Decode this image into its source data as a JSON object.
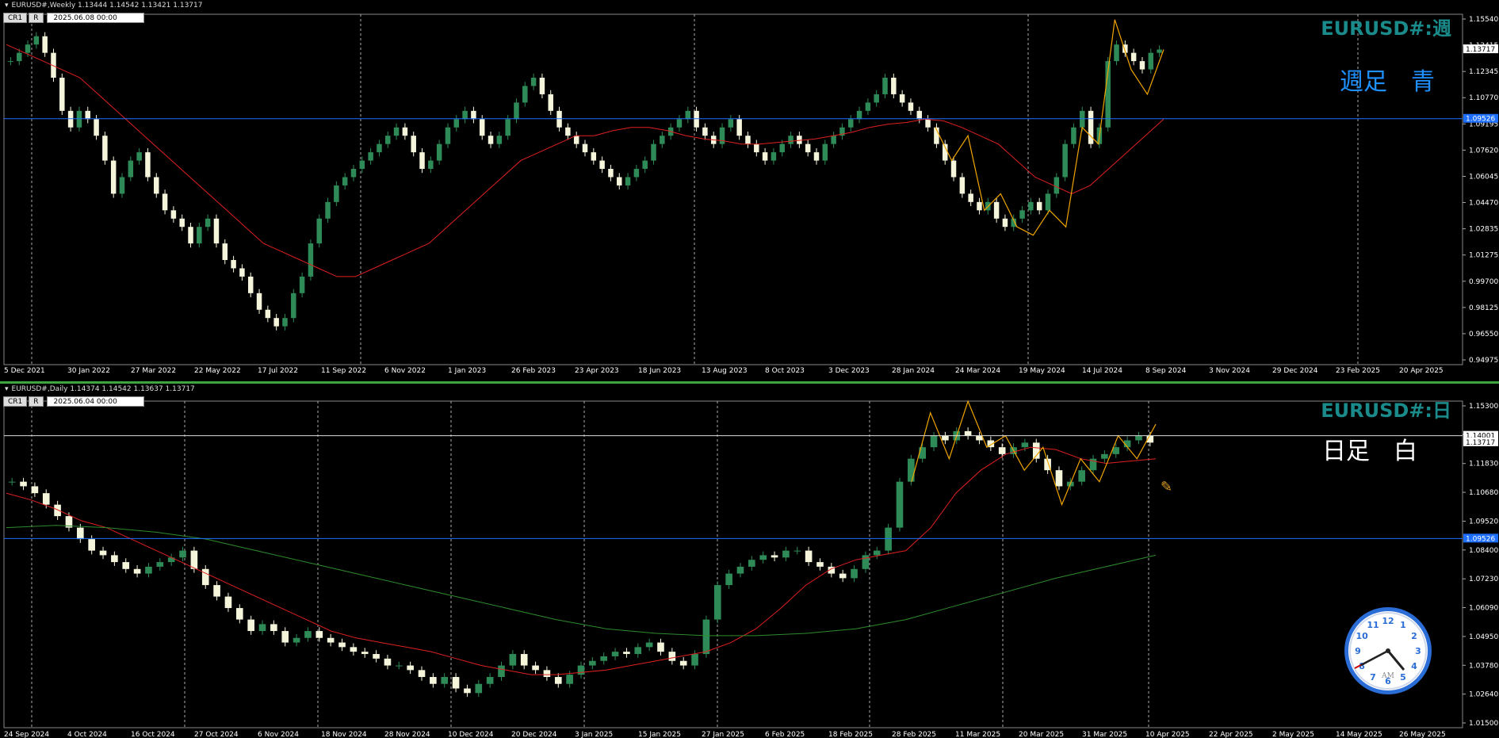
{
  "weekly": {
    "info": "EURUSD#,Weekly  1.13444 1.14542 1.13421 1.13717",
    "btn_cr": "CR1",
    "btn_r": "R",
    "datetime": "2025.06.08 00:00",
    "title": "EURUSD#:週",
    "subtitle": "週足　青",
    "subtitle_color": "#1e90ff",
    "hline_price": 1.09526,
    "hline_label": "1.09526",
    "last_label": "1.13717",
    "price_ticks": [
      "1.15540",
      "1.13415",
      "1.12345",
      "1.10770",
      "1.09195",
      "1.07620",
      "1.06045",
      "1.04470",
      "1.02835",
      "1.01275",
      "0.99700",
      "0.98125",
      "0.96550",
      "0.94975"
    ],
    "date_ticks": [
      "5 Dec 2021",
      "30 Jan 2022",
      "27 Mar 2022",
      "22 May 2022",
      "17 Jul 2022",
      "11 Sep 2022",
      "6 Nov 2022",
      "1 Jan 2023",
      "26 Feb 2023",
      "23 Apr 2023",
      "18 Jun 2023",
      "13 Aug 2023",
      "8 Oct 2023",
      "3 Dec 2023",
      "28 Jan 2024",
      "24 Mar 2024",
      "19 May 2024",
      "14 Jul 2024",
      "8 Sep 2024",
      "3 Nov 2024",
      "29 Dec 2024",
      "23 Feb 2025",
      "20 Apr 2025"
    ]
  },
  "daily": {
    "info": "EURUSD#,Daily  1.14374 1.14542 1.13637 1.13717",
    "btn_cr": "CR1",
    "btn_r": "R",
    "datetime": "2025.06.04 00:00",
    "title": "EURUSD#:日",
    "subtitle": "日足　白",
    "subtitle_color": "#ffffff",
    "hline_blue_price": 1.09526,
    "hline_blue_label": "1.09526",
    "hline_white_price": 1.14001,
    "hline_white_label": "1.14001",
    "last_label": "1.13717",
    "price_ticks": [
      "1.15300",
      "1.12990",
      "1.11830",
      "1.10680",
      "1.09520",
      "1.08400",
      "1.07230",
      "1.06090",
      "1.04950",
      "1.03780",
      "1.02640",
      "1.01500"
    ],
    "date_ticks": [
      "24 Sep 2024",
      "4 Oct 2024",
      "16 Oct 2024",
      "27 Oct 2024",
      "6 Nov 2024",
      "18 Nov 2024",
      "28 Nov 2024",
      "10 Dec 2024",
      "20 Dec 2024",
      "3 Jan 2025",
      "15 Jan 2025",
      "27 Jan 2025",
      "6 Feb 2025",
      "18 Feb 2025",
      "28 Feb 2025",
      "11 Mar 2025",
      "20 Mar 2025",
      "31 Mar 2025",
      "10 Apr 2025",
      "22 Apr 2025",
      "2 May 2025",
      "14 May 2025",
      "26 May 2025"
    ]
  },
  "clock": {
    "numbers": [
      "12",
      "1",
      "2",
      "3",
      "4",
      "5",
      "6",
      "7",
      "8",
      "9",
      "10",
      "11"
    ],
    "ampm": "AM"
  },
  "chart_data": [
    {
      "type": "candlestick",
      "title": "EURUSD#:週",
      "timeframe": "Weekly",
      "ylim": [
        0.94975,
        1.1554
      ],
      "series": [
        {
          "name": "close",
          "values": [
            1.13,
            1.135,
            1.14,
            1.145,
            1.135,
            1.12,
            1.1,
            1.09,
            1.1,
            1.095,
            1.085,
            1.07,
            1.05,
            1.06,
            1.07,
            1.075,
            1.06,
            1.05,
            1.04,
            1.035,
            1.03,
            1.02,
            1.03,
            1.035,
            1.02,
            1.01,
            1.005,
            1.0,
            0.99,
            0.98,
            0.975,
            0.97,
            0.975,
            0.99,
            1.0,
            1.02,
            1.035,
            1.045,
            1.055,
            1.06,
            1.065,
            1.07,
            1.075,
            1.08,
            1.085,
            1.09,
            1.085,
            1.075,
            1.065,
            1.07,
            1.08,
            1.09,
            1.095,
            1.1,
            1.095,
            1.085,
            1.08,
            1.085,
            1.095,
            1.105,
            1.115,
            1.12,
            1.11,
            1.1,
            1.09,
            1.085,
            1.08,
            1.075,
            1.07,
            1.065,
            1.06,
            1.055,
            1.06,
            1.065,
            1.07,
            1.08,
            1.085,
            1.09,
            1.095,
            1.1,
            1.09,
            1.085,
            1.08,
            1.09,
            1.095,
            1.085,
            1.08,
            1.075,
            1.07,
            1.075,
            1.08,
            1.085,
            1.08,
            1.075,
            1.07,
            1.08,
            1.085,
            1.09,
            1.095,
            1.1,
            1.105,
            1.11,
            1.12,
            1.11,
            1.105,
            1.1,
            1.095,
            1.09,
            1.08,
            1.07,
            1.06,
            1.05,
            1.045,
            1.04,
            1.045,
            1.035,
            1.03,
            1.035,
            1.04,
            1.045,
            1.04,
            1.05,
            1.06,
            1.08,
            1.09,
            1.1,
            1.08,
            1.09,
            1.13,
            1.14,
            1.135,
            1.13,
            1.125,
            1.135,
            1.137
          ]
        },
        {
          "name": "MA",
          "values": [
            1.14,
            1.135,
            1.13,
            1.125,
            1.12,
            1.11,
            1.1,
            1.09,
            1.08,
            1.07,
            1.06,
            1.05,
            1.04,
            1.03,
            1.02,
            1.015,
            1.01,
            1.005,
            1.0,
            1.0,
            1.005,
            1.01,
            1.015,
            1.02,
            1.03,
            1.04,
            1.05,
            1.06,
            1.07,
            1.075,
            1.08,
            1.085,
            1.085,
            1.088,
            1.09,
            1.09,
            1.088,
            1.085,
            1.083,
            1.082,
            1.08,
            1.08,
            1.081,
            1.082,
            1.083,
            1.085,
            1.087,
            1.09,
            1.092,
            1.093,
            1.095,
            1.094,
            1.09,
            1.085,
            1.08,
            1.07,
            1.06,
            1.055,
            1.05,
            1.055,
            1.065,
            1.075,
            1.085,
            1.095
          ]
        }
      ]
    },
    {
      "type": "candlestick",
      "title": "EURUSD#:日",
      "timeframe": "Daily",
      "ylim": [
        1.015,
        1.153
      ],
      "series": [
        {
          "name": "close",
          "values": [
            1.12,
            1.118,
            1.115,
            1.11,
            1.105,
            1.1,
            1.095,
            1.09,
            1.088,
            1.085,
            1.082,
            1.08,
            1.083,
            1.085,
            1.087,
            1.09,
            1.082,
            1.075,
            1.07,
            1.065,
            1.06,
            1.055,
            1.058,
            1.055,
            1.05,
            1.052,
            1.055,
            1.052,
            1.05,
            1.048,
            1.046,
            1.045,
            1.043,
            1.04,
            1.04,
            1.038,
            1.035,
            1.032,
            1.035,
            1.03,
            1.028,
            1.032,
            1.035,
            1.04,
            1.045,
            1.04,
            1.038,
            1.035,
            1.032,
            1.036,
            1.04,
            1.042,
            1.044,
            1.046,
            1.045,
            1.048,
            1.05,
            1.046,
            1.042,
            1.04,
            1.045,
            1.06,
            1.075,
            1.08,
            1.083,
            1.086,
            1.088,
            1.087,
            1.09,
            1.09,
            1.085,
            1.083,
            1.08,
            1.078,
            1.082,
            1.088,
            1.09,
            1.1,
            1.12,
            1.13,
            1.135,
            1.14,
            1.138,
            1.142,
            1.14,
            1.138,
            1.135,
            1.132,
            1.135,
            1.137,
            1.13,
            1.125,
            1.118,
            1.12,
            1.125,
            1.13,
            1.132,
            1.135,
            1.138,
            1.14,
            1.137
          ]
        },
        {
          "name": "MA short",
          "values": [
            1.115,
            1.112,
            1.108,
            1.103,
            1.1,
            1.095,
            1.09,
            1.085,
            1.08,
            1.075,
            1.07,
            1.065,
            1.06,
            1.055,
            1.052,
            1.05,
            1.048,
            1.046,
            1.043,
            1.04,
            1.038,
            1.036,
            1.036,
            1.037,
            1.038,
            1.04,
            1.042,
            1.044,
            1.046,
            1.05,
            1.056,
            1.065,
            1.075,
            1.082,
            1.086,
            1.088,
            1.09,
            1.1,
            1.115,
            1.125,
            1.132,
            1.135,
            1.134,
            1.13,
            1.128,
            1.129,
            1.13
          ]
        },
        {
          "name": "MA long",
          "values": [
            1.1,
            1.101,
            1.1,
            1.098,
            1.095,
            1.09,
            1.085,
            1.08,
            1.075,
            1.07,
            1.065,
            1.06,
            1.056,
            1.054,
            1.053,
            1.053,
            1.054,
            1.056,
            1.06,
            1.066,
            1.072,
            1.078,
            1.083,
            1.088
          ]
        }
      ]
    }
  ]
}
